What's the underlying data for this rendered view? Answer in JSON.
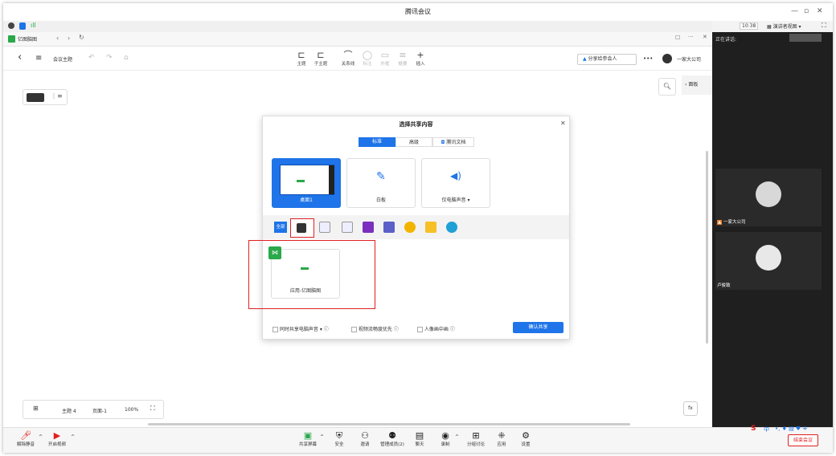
{
  "window": {
    "title": "腾讯会议",
    "time": "10:38",
    "view_mode": "演讲者视图"
  },
  "app": {
    "tab_label": "亿图脑图",
    "back_label": "<",
    "doc_title": "会议主题"
  },
  "toolbar": {
    "items": [
      {
        "icon": "topic-icon",
        "label": "主题",
        "glyph": "⊏"
      },
      {
        "icon": "subtopic-icon",
        "label": "子主题",
        "glyph": "⊏"
      },
      {
        "icon": "relation-icon",
        "label": "关系线",
        "glyph": "⌒"
      },
      {
        "icon": "callout-icon",
        "label": "标注",
        "glyph": "◯"
      },
      {
        "icon": "outline-icon",
        "label": "外框",
        "glyph": "▭"
      },
      {
        "icon": "summary-icon",
        "label": "概要",
        "glyph": "≡"
      },
      {
        "icon": "insert-icon",
        "label": "插入",
        "glyph": "+"
      }
    ],
    "share_button": "分享给参会人",
    "more": "•••",
    "company": "一家大公司",
    "panel_label": "面板"
  },
  "canvas_status": {
    "topic_count": "主题 4",
    "page": "页面-1",
    "zoom": "100%"
  },
  "dialog": {
    "title": "选择共享内容",
    "tabs": [
      "标准",
      "高级",
      "腾讯文档"
    ],
    "cards": [
      "桌面1",
      "白板",
      "仅电脑声音"
    ],
    "filter_all": "全部",
    "app_window_label": "应用-亿图脑图",
    "options": [
      "同时共享电脑声音",
      "视频流畅度优先",
      "人像画中画"
    ],
    "confirm": "确认共享",
    "accent": "#1e74e8"
  },
  "right_panel": {
    "speaking_label": "正在讲话:",
    "participant1": "一家大公司",
    "participant2": "卢俊致"
  },
  "bottom_bar": {
    "left": [
      {
        "icon": "mic-off-icon",
        "label": "解除静音",
        "glyph": "🎤"
      },
      {
        "icon": "video-off-icon",
        "label": "开启视频",
        "glyph": "🎥"
      }
    ],
    "center": [
      {
        "icon": "share-screen-icon",
        "label": "共享屏幕",
        "glyph": "▣"
      },
      {
        "icon": "security-icon",
        "label": "安全",
        "glyph": "⛨"
      },
      {
        "icon": "invite-icon",
        "label": "邀请",
        "glyph": "⚇"
      },
      {
        "icon": "members-icon",
        "label": "管理成员(2)",
        "glyph": "⚉"
      },
      {
        "icon": "chat-icon",
        "label": "聊天",
        "glyph": "▤"
      },
      {
        "icon": "record-icon",
        "label": "录制",
        "glyph": "◉"
      },
      {
        "icon": "breakout-icon",
        "label": "分组讨论",
        "glyph": "⊞"
      },
      {
        "icon": "apps-icon",
        "label": "应用",
        "glyph": "⁜"
      },
      {
        "icon": "settings-icon",
        "label": "设置",
        "glyph": "⚙"
      }
    ],
    "end_meeting": "结束会议",
    "ime": "中"
  }
}
